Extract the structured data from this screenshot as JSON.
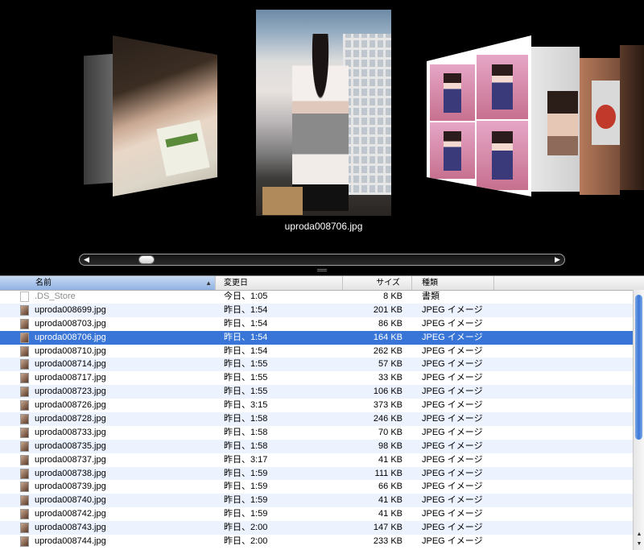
{
  "coverflow": {
    "caption": "uproda008706.jpg"
  },
  "columns": {
    "name": "名前",
    "date": "変更日",
    "size": "サイズ",
    "kind": "種類"
  },
  "rows": [
    {
      "name": ".DS_Store",
      "date": "今日、1:05",
      "size": "8 KB",
      "kind": "書類"
    },
    {
      "name": "uproda008699.jpg",
      "date": "昨日、1:54",
      "size": "201 KB",
      "kind": "JPEG イメージ"
    },
    {
      "name": "uproda008703.jpg",
      "date": "昨日、1:54",
      "size": "86 KB",
      "kind": "JPEG イメージ"
    },
    {
      "name": "uproda008706.jpg",
      "date": "昨日、1:54",
      "size": "164 KB",
      "kind": "JPEG イメージ"
    },
    {
      "name": "uproda008710.jpg",
      "date": "昨日、1:54",
      "size": "262 KB",
      "kind": "JPEG イメージ"
    },
    {
      "name": "uproda008714.jpg",
      "date": "昨日、1:55",
      "size": "57 KB",
      "kind": "JPEG イメージ"
    },
    {
      "name": "uproda008717.jpg",
      "date": "昨日、1:55",
      "size": "33 KB",
      "kind": "JPEG イメージ"
    },
    {
      "name": "uproda008723.jpg",
      "date": "昨日、1:55",
      "size": "106 KB",
      "kind": "JPEG イメージ"
    },
    {
      "name": "uproda008726.jpg",
      "date": "昨日、3:15",
      "size": "373 KB",
      "kind": "JPEG イメージ"
    },
    {
      "name": "uproda008728.jpg",
      "date": "昨日、1:58",
      "size": "246 KB",
      "kind": "JPEG イメージ"
    },
    {
      "name": "uproda008733.jpg",
      "date": "昨日、1:58",
      "size": "70 KB",
      "kind": "JPEG イメージ"
    },
    {
      "name": "uproda008735.jpg",
      "date": "昨日、1:58",
      "size": "98 KB",
      "kind": "JPEG イメージ"
    },
    {
      "name": "uproda008737.jpg",
      "date": "昨日、3:17",
      "size": "41 KB",
      "kind": "JPEG イメージ"
    },
    {
      "name": "uproda008738.jpg",
      "date": "昨日、1:59",
      "size": "111 KB",
      "kind": "JPEG イメージ"
    },
    {
      "name": "uproda008739.jpg",
      "date": "昨日、1:59",
      "size": "66 KB",
      "kind": "JPEG イメージ"
    },
    {
      "name": "uproda008740.jpg",
      "date": "昨日、1:59",
      "size": "41 KB",
      "kind": "JPEG イメージ"
    },
    {
      "name": "uproda008742.jpg",
      "date": "昨日、1:59",
      "size": "41 KB",
      "kind": "JPEG イメージ"
    },
    {
      "name": "uproda008743.jpg",
      "date": "昨日、2:00",
      "size": "147 KB",
      "kind": "JPEG イメージ"
    },
    {
      "name": "uproda008744.jpg",
      "date": "昨日、2:00",
      "size": "233 KB",
      "kind": "JPEG イメージ"
    }
  ],
  "selected_row": 3,
  "colors": {
    "selection": "#3875d7",
    "alt_row": "#edf3fe",
    "header_sorted": "#8fb1e2"
  }
}
